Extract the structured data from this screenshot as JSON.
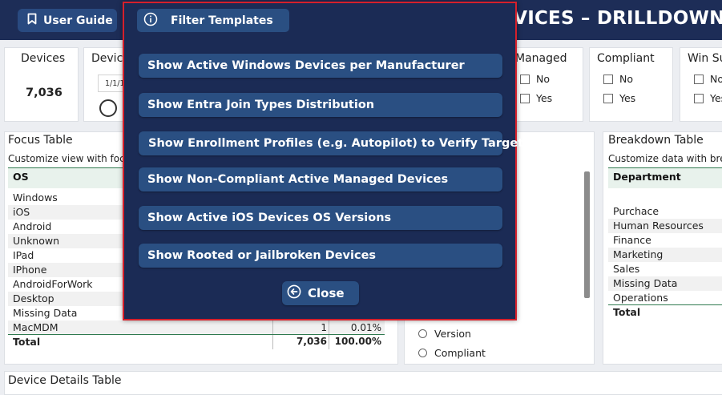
{
  "header": {
    "user_guide_label": "User Guide",
    "page_title": "DEVICES – DRILLDOWN"
  },
  "cards": {
    "devices_title": "Devices",
    "devices_value": "7,036",
    "device_partial_title": "Devic",
    "device_date_partial": "1/1/1",
    "managed_title": "Managed",
    "managed_options": [
      "No",
      "Yes"
    ],
    "compliant_title": "Compliant",
    "compliant_options": [
      "No",
      "Yes"
    ],
    "winsu_title": "Win Su",
    "winsu_options": [
      "No",
      "Yes"
    ]
  },
  "focus_table": {
    "title": "Focus Table",
    "subtitle": "Customize view with focus",
    "column_header": "OS",
    "rows": [
      "Windows",
      "iOS",
      "Android",
      "Unknown",
      "IPad",
      "IPhone",
      "AndroidForWork",
      "Desktop",
      "Missing Data",
      "MacMDM"
    ],
    "last_row_count": "1",
    "last_row_pct": "0.01%",
    "total_label": "Total",
    "total_count": "7,036",
    "total_pct": "100.00%"
  },
  "middle_panel": {
    "radio_options": [
      "Version",
      "Compliant"
    ]
  },
  "breakdown_table": {
    "title": "Breakdown Table",
    "subtitle": "Customize data with breal",
    "column_header": "Department",
    "rows": [
      "Purchace",
      "Human Resources",
      "Finance",
      "Marketing",
      "Sales",
      "Missing Data",
      "Operations"
    ],
    "total_label": "Total"
  },
  "device_details": {
    "title": "Device Details Table"
  },
  "modal": {
    "filter_label": "Filter Templates",
    "templates": [
      "Show Active Windows Devices per Manufacturer",
      "Show Entra Join Types Distribution",
      "Show Enrollment Profiles (e.g. Autopilot) to Verify Targeting",
      "Show Non-Compliant Active Managed Devices",
      "Show Active iOS Devices OS Versions",
      "Show Rooted or Jailbroken Devices"
    ],
    "close_label": "Close"
  },
  "colors": {
    "header_bg": "#1d2d57",
    "modal_bg": "#1b2b55",
    "button_bg": "#2a4f82",
    "modal_border": "#d6202b",
    "table_accent": "#2f7a4f"
  },
  "icons": {
    "user_guide": "bookmark-icon",
    "filter": "info-icon",
    "close": "arrow-left-circle-icon"
  }
}
